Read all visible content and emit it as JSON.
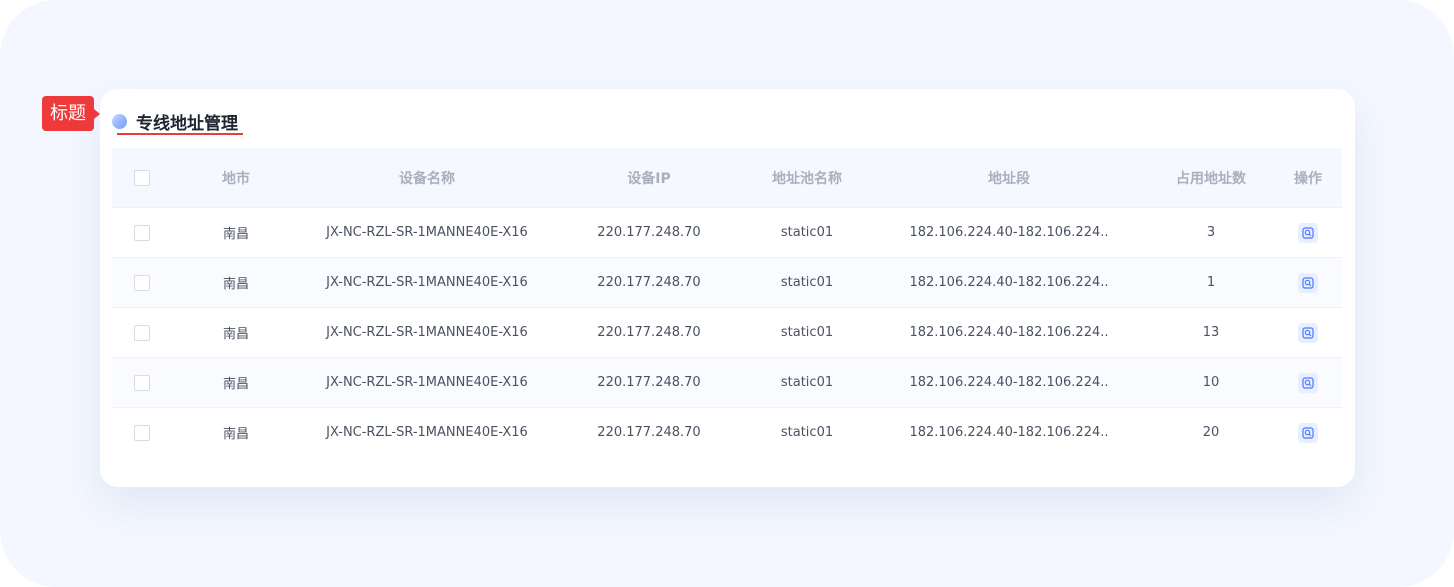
{
  "tag": {
    "label": "标题"
  },
  "panel": {
    "title": "专线地址管理"
  },
  "table": {
    "headers": [
      "地市",
      "设备名称",
      "设备IP",
      "地址池名称",
      "地址段",
      "占用地址数",
      "操作"
    ],
    "rows": [
      [
        "南昌",
        "JX-NC-RZL-SR-1MANNE40E-X16",
        "220.177.248.70",
        "static01",
        "182.106.224.40-182.106.224..",
        "3"
      ],
      [
        "南昌",
        "JX-NC-RZL-SR-1MANNE40E-X16",
        "220.177.248.70",
        "static01",
        "182.106.224.40-182.106.224..",
        "1"
      ],
      [
        "南昌",
        "JX-NC-RZL-SR-1MANNE40E-X16",
        "220.177.248.70",
        "static01",
        "182.106.224.40-182.106.224..",
        "13"
      ],
      [
        "南昌",
        "JX-NC-RZL-SR-1MANNE40E-X16",
        "220.177.248.70",
        "static01",
        "182.106.224.40-182.106.224..",
        "10"
      ],
      [
        "南昌",
        "JX-NC-RZL-SR-1MANNE40E-X16",
        "220.177.248.70",
        "static01",
        "182.106.224.40-182.106.224..",
        "20"
      ]
    ],
    "op_icon": "view-icon"
  },
  "colors": {
    "accent": "#ef3a3a",
    "header_bg": "#f5f8ff",
    "icon_blue": "#4d78ff"
  }
}
